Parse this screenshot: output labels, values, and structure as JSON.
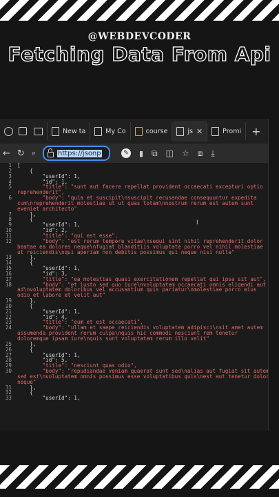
{
  "overlay": {
    "handle": "@WEBDEVCODER",
    "headline": "Fetching Data From Api"
  },
  "tabs": [
    {
      "label": "New ta"
    },
    {
      "label": "My Co"
    },
    {
      "label": "course"
    },
    {
      "label": "js",
      "active": true
    },
    {
      "label": "Promi"
    }
  ],
  "toolbar": {
    "url": "https://jsonp"
  },
  "code_lines": [
    {
      "n": "1",
      "t": "["
    },
    {
      "n": "2",
      "t": "    {"
    },
    {
      "n": "3",
      "t": "        \"userId\": 1,"
    },
    {
      "n": "4",
      "t": "        \"id\": 1,"
    },
    {
      "n": "5",
      "t": "        \"title\": \"sunt aut facere repellat provident occaecati excepturi optio"
    },
    {
      "n": "",
      "t": "reprehenderit\","
    },
    {
      "n": "6",
      "t": "        \"body\": \"quia et suscipit\\nsuscipit recusandae consequuntur expedita"
    },
    {
      "n": "",
      "t": "cum\\nreprehenderit molestiae ut ut quas totam\\nnostrum rerum est autem sunt"
    },
    {
      "n": "",
      "t": "eveniet architecto\""
    },
    {
      "n": "7",
      "t": "    },"
    },
    {
      "n": "8",
      "t": "    {"
    },
    {
      "n": "9",
      "t": "        \"userId\": 1,"
    },
    {
      "n": "10",
      "t": "        \"id\": 2,"
    },
    {
      "n": "11",
      "t": "        \"title\": \"qui est esse\","
    },
    {
      "n": "12",
      "t": "        \"body\": \"est rerum tempore vitae\\nsequi sint nihil reprehenderit dolor"
    },
    {
      "n": "",
      "t": "beatae ea dolores neque\\nfugiat blanditiis voluptate porro vel nihil molestiae"
    },
    {
      "n": "",
      "t": "ut reiciendis\\nqui aperiam non debitis possimus qui neque nisi nulla\""
    },
    {
      "n": "13",
      "t": "    },"
    },
    {
      "n": "14",
      "t": "    {"
    },
    {
      "n": "15",
      "t": "        \"userId\": 1,"
    },
    {
      "n": "16",
      "t": "        \"id\": 3,"
    },
    {
      "n": "17",
      "t": "        \"title\": \"ea molestias quasi exercitationem repellat qui ipsa sit aut\","
    },
    {
      "n": "18",
      "t": "        \"body\": \"et iusto sed quo iure\\nvoluptatem occaecati omnis eligendi aut"
    },
    {
      "n": "",
      "t": "ad\\nvoluptatem doloribus vel accusantium quis pariatur\\nmolestiae porro eius"
    },
    {
      "n": "",
      "t": "odio et labore et velit aut\""
    },
    {
      "n": "19",
      "t": "    },"
    },
    {
      "n": "20",
      "t": "    {"
    },
    {
      "n": "21",
      "t": "        \"userId\": 1,"
    },
    {
      "n": "22",
      "t": "        \"id\": 4,"
    },
    {
      "n": "23",
      "t": "        \"title\": \"eum et est occaecati\","
    },
    {
      "n": "24",
      "t": "        \"body\": \"ullam et saepe reiciendis voluptatem adipisci\\nsit amet autem"
    },
    {
      "n": "",
      "t": "assumenda provident rerum culpa\\nquis hic commodi nesciunt rem tenetur"
    },
    {
      "n": "",
      "t": "doloremque ipsam iure\\nquis sunt voluptatem rerum illo velit\""
    },
    {
      "n": "25",
      "t": "    },"
    },
    {
      "n": "26",
      "t": "    {"
    },
    {
      "n": "27",
      "t": "        \"userId\": 1,"
    },
    {
      "n": "28",
      "t": "        \"id\": 5,"
    },
    {
      "n": "29",
      "t": "        \"title\": \"nesciunt quas odio\","
    },
    {
      "n": "30",
      "t": "        \"body\": \"repudiandae veniam quaerat sunt sed\\nalias aut fugiat sit autem"
    },
    {
      "n": "",
      "t": "sed est\\nvoluptatem omnis possimus esse voluptatibus quis\\nest aut tenetur dolor"
    },
    {
      "n": "",
      "t": "neque\""
    },
    {
      "n": "31",
      "t": "    },"
    },
    {
      "n": "32",
      "t": "    {"
    },
    {
      "n": "33",
      "t": "        \"userId\": 1,"
    }
  ]
}
